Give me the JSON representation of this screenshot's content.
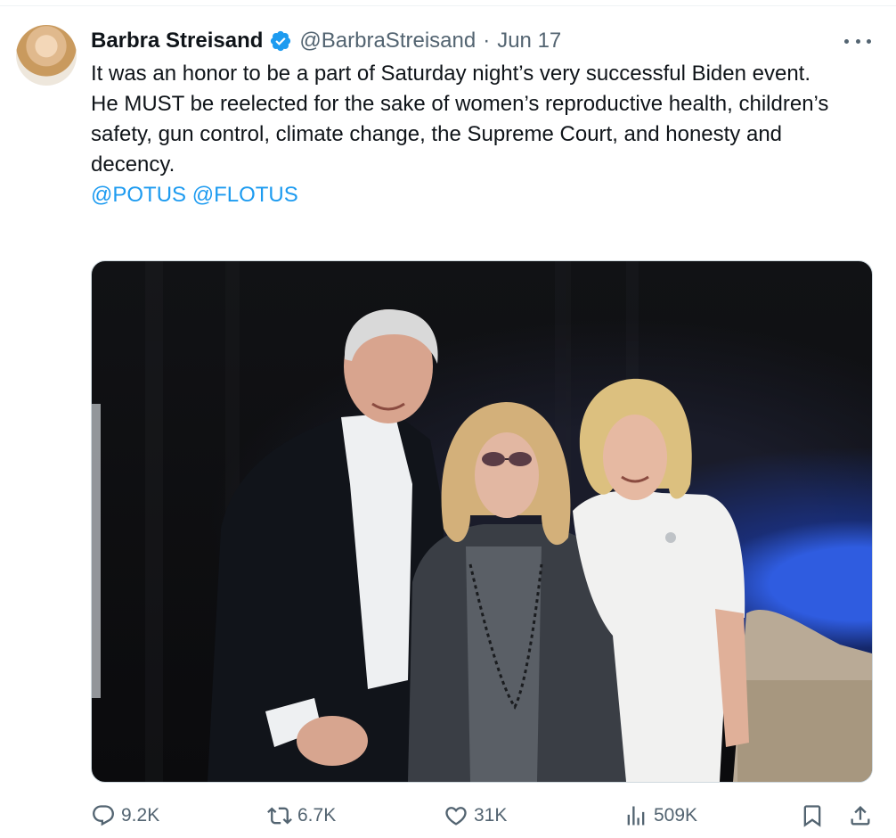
{
  "tweet": {
    "author": {
      "display_name": "Barbra Streisand",
      "handle": "@BarbraStreisand",
      "verified": true
    },
    "separator": "·",
    "date": "Jun 17",
    "text_lines": [
      "It was an honor to be a part of Saturday night’s very successful Biden event.",
      "He MUST be reelected for the sake of women’s reproductive health, children’s safety, gun control, climate change, the Supreme Court, and honesty and decency."
    ],
    "mentions": "@POTUS @FLOTUS",
    "media": {
      "icon": "photo"
    },
    "actions": {
      "replies": "9.2K",
      "reposts": "6.7K",
      "likes": "31K",
      "views": "509K"
    }
  },
  "colors": {
    "accent": "#1d9bf0",
    "text": "#0f1419",
    "muted": "#536471",
    "border": "#cfd9de"
  },
  "icons": [
    "verified-badge-icon",
    "more-icon",
    "reply-icon",
    "repost-icon",
    "like-icon",
    "views-icon",
    "bookmark-icon",
    "share-icon"
  ]
}
